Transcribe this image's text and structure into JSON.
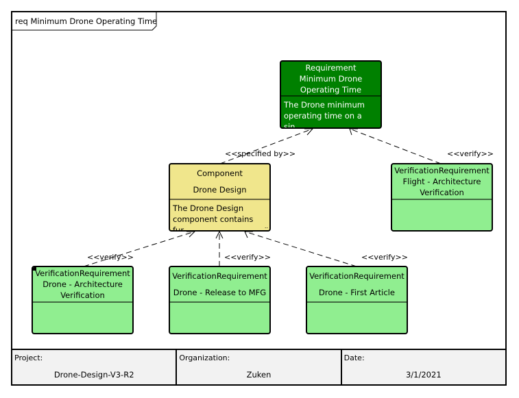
{
  "diagram": {
    "title": "req Minimum Drone Operating Time",
    "nodes": {
      "requirement": {
        "stereotype": "Requirement",
        "name_line1": "Minimum Drone",
        "name_line2": "Operating Time",
        "description_line1": "The Drone minimum",
        "description_line2": "operating time on a sin...",
        "color": "#008000"
      },
      "component": {
        "stereotype": "Component",
        "name": "Drone Design",
        "description_line1": "The Drone Design",
        "description_line2": "component contains fur...",
        "color": "#f0e68c"
      },
      "flight_verification": {
        "stereotype": "VerificationRequirement",
        "name_line1": "Flight - Architecture",
        "name_line2": "Verification",
        "color": "#90ee90"
      },
      "drone_arch_verification": {
        "stereotype": "VerificationRequirement",
        "name_line1": "Drone - Architecture",
        "name_line2": "Verification",
        "color": "#90ee90"
      },
      "drone_release": {
        "stereotype": "VerificationRequirement",
        "name": "Drone - Release to MFG",
        "color": "#90ee90"
      },
      "drone_first_article": {
        "stereotype": "VerificationRequirement",
        "name": "Drone - First Article",
        "color": "#90ee90"
      }
    },
    "edges": {
      "specified_by": "<<specified by>>",
      "verify_flight": "<<verify>>",
      "verify_arch": "<<verify>>",
      "verify_release": "<<verify>>",
      "verify_first_article": "<<verify>>"
    }
  },
  "footer": {
    "project_label": "Project:",
    "project_value": "Drone-Design-V3-R2",
    "organization_label": "Organization:",
    "organization_value": "Zuken",
    "date_label": "Date:",
    "date_value": "3/1/2021"
  }
}
